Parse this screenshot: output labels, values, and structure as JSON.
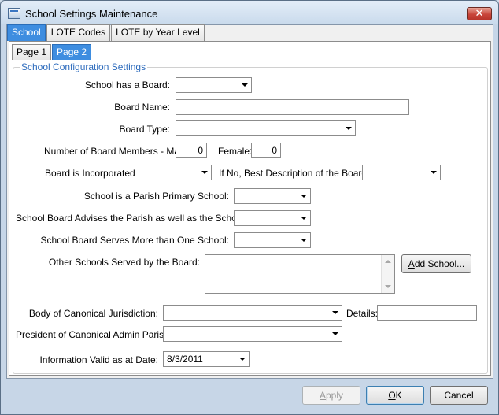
{
  "window": {
    "title": "School Settings Maintenance",
    "close_glyph": "✕"
  },
  "tabs": [
    {
      "label": "School",
      "active": true
    },
    {
      "label": "LOTE Codes",
      "active": false
    },
    {
      "label": "LOTE by Year Level",
      "active": false
    }
  ],
  "page_tabs": [
    {
      "label": "Page 1",
      "active": false
    },
    {
      "label": "Page 2",
      "active": true
    }
  ],
  "group": {
    "title": "School Configuration Settings"
  },
  "form": {
    "school_has_board": {
      "label": "School has a Board:",
      "value": ""
    },
    "board_name": {
      "label": "Board Name:",
      "value": ""
    },
    "board_type": {
      "label": "Board Type:",
      "value": ""
    },
    "members_male": {
      "label": "Number of Board Members - Male:",
      "value": "0"
    },
    "members_female": {
      "label": "Female:",
      "value": "0"
    },
    "board_incorporated": {
      "label": "Board is Incorporated:",
      "value": ""
    },
    "board_description": {
      "label": "If No, Best Description of the Board:",
      "value": ""
    },
    "parish_primary": {
      "label": "School is a Parish Primary School:",
      "value": ""
    },
    "advises_parish": {
      "label": "School Board Advises the Parish as well as the School:",
      "value": ""
    },
    "serves_more": {
      "label": "School Board Serves More than One School:",
      "value": ""
    },
    "other_schools": {
      "label": "Other Schools Served by the Board:"
    },
    "add_school_button": {
      "label_prefix": "A",
      "label_rest": "dd School..."
    },
    "canonical_body": {
      "label": "Body of Canonical Jurisdiction:",
      "value": ""
    },
    "details": {
      "label": "Details:",
      "value": ""
    },
    "president_parish": {
      "label": "President of Canonical Admin Parish:",
      "value": ""
    },
    "valid_date": {
      "label": "Information Valid as at Date:",
      "value": "8/3/2011"
    }
  },
  "footer": {
    "apply": {
      "label_prefix": "A",
      "label_rest": "pply",
      "enabled": false
    },
    "ok": {
      "label_prefix": "O",
      "label_rest": "K"
    },
    "cancel": {
      "label": "Cancel"
    }
  }
}
